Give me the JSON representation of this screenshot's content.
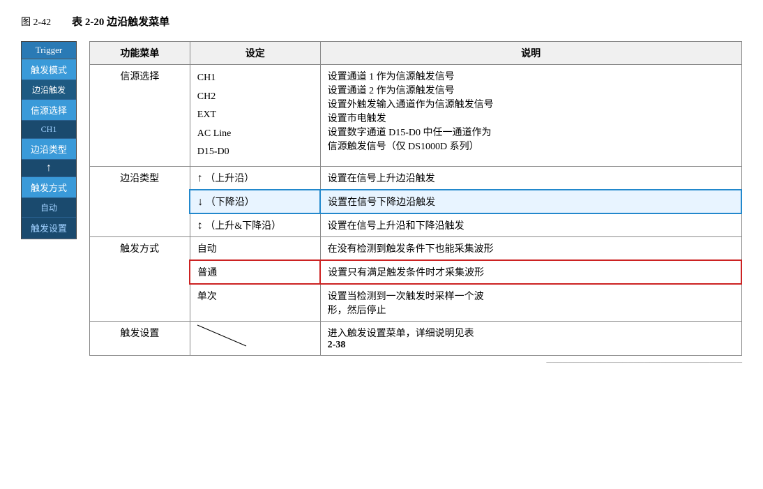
{
  "page": {
    "fig_label": "图 2-42",
    "table_caption": "表 2-20  边沿触发菜单"
  },
  "sidebar": {
    "header": "Trigger",
    "items": [
      {
        "id": "trigger-mode",
        "label": "触发模式",
        "type": "active"
      },
      {
        "id": "edge-trigger",
        "label": "边沿触发",
        "type": "sub-highlight"
      },
      {
        "id": "source-select",
        "label": "信源选择",
        "type": "active"
      },
      {
        "id": "ch1",
        "label": "CH1",
        "type": "sub"
      },
      {
        "id": "edge-type",
        "label": "边沿类型",
        "type": "active"
      },
      {
        "id": "arrow-up",
        "label": "↑",
        "type": "arrow"
      },
      {
        "id": "trigger-mode2",
        "label": "触发方式",
        "type": "active"
      },
      {
        "id": "auto",
        "label": "自动",
        "type": "sub"
      },
      {
        "id": "trigger-settings",
        "label": "触发设置",
        "type": "active"
      }
    ]
  },
  "table": {
    "headers": [
      "功能菜单",
      "设定",
      "说明"
    ],
    "rows": [
      {
        "id": "source",
        "menu": "信源选择",
        "settings": [
          "CH1",
          "CH2",
          "EXT",
          "AC Line",
          "D15-D0"
        ],
        "descriptions": [
          "设置通道 1 作为信源触发信号",
          "设置通道 2 作为信源触发信号",
          "设置外触发输入通道作为信源触发信号",
          "设置市电触发",
          "设置数字通道 D15-D0 中任一通道作为信源触发信号（仅 DS1000D 系列）"
        ]
      },
      {
        "id": "edge-type",
        "menu": "边沿类型",
        "sub_rows": [
          {
            "id": "rising",
            "icon": "↑",
            "icon_label": "（上升沿）",
            "desc": "设置在信号上升边沿触发",
            "highlighted": false
          },
          {
            "id": "falling",
            "icon": "↓",
            "icon_label": "（下降沿）",
            "desc": "设置在信号下降边沿触发",
            "highlighted": true
          },
          {
            "id": "both",
            "icon": "↕",
            "icon_label": "（上升&下降沿）",
            "desc": "设置在信号上升沿和下降沿触发",
            "highlighted": false
          }
        ]
      },
      {
        "id": "trigger-mode",
        "menu": "触发方式",
        "sub_rows": [
          {
            "id": "auto",
            "setting": "自动",
            "desc": "在没有检测到触发条件下也能采集波形",
            "highlighted": false
          },
          {
            "id": "normal",
            "setting": "普通",
            "desc": "设置只有满足触发条件时才采集波形",
            "highlighted": true
          },
          {
            "id": "single",
            "setting": "单次",
            "desc": "设置当检测到一次触发时采样一个波形，然后停止",
            "highlighted": false
          }
        ]
      },
      {
        "id": "trigger-settings",
        "menu": "触发设置",
        "settings": "",
        "desc": "进入触发设置菜单，详细说明见表 2-38"
      }
    ]
  }
}
